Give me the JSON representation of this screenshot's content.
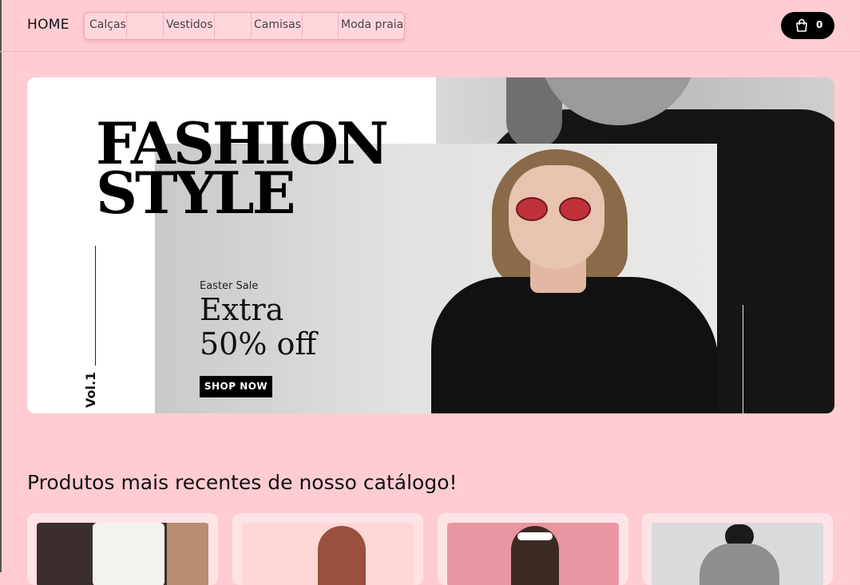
{
  "nav": {
    "home": "HOME",
    "categories": [
      "Calças",
      "Vestidos",
      "Camisas",
      "Moda praia"
    ],
    "cart_count": "0"
  },
  "banner": {
    "title_line1": "FASHION",
    "title_line2": "STYLE",
    "volume": "Vol.1",
    "eyebrow": "Easter Sale",
    "headline_line1": "Extra",
    "headline_line2": "50% off",
    "cta": "SHOP NOW"
  },
  "products": {
    "heading": "Produtos mais recentes de nosso catálogo!"
  },
  "colors": {
    "background": "#ffccd3",
    "card": "#ffe4e7",
    "accent_dark": "#000000"
  }
}
